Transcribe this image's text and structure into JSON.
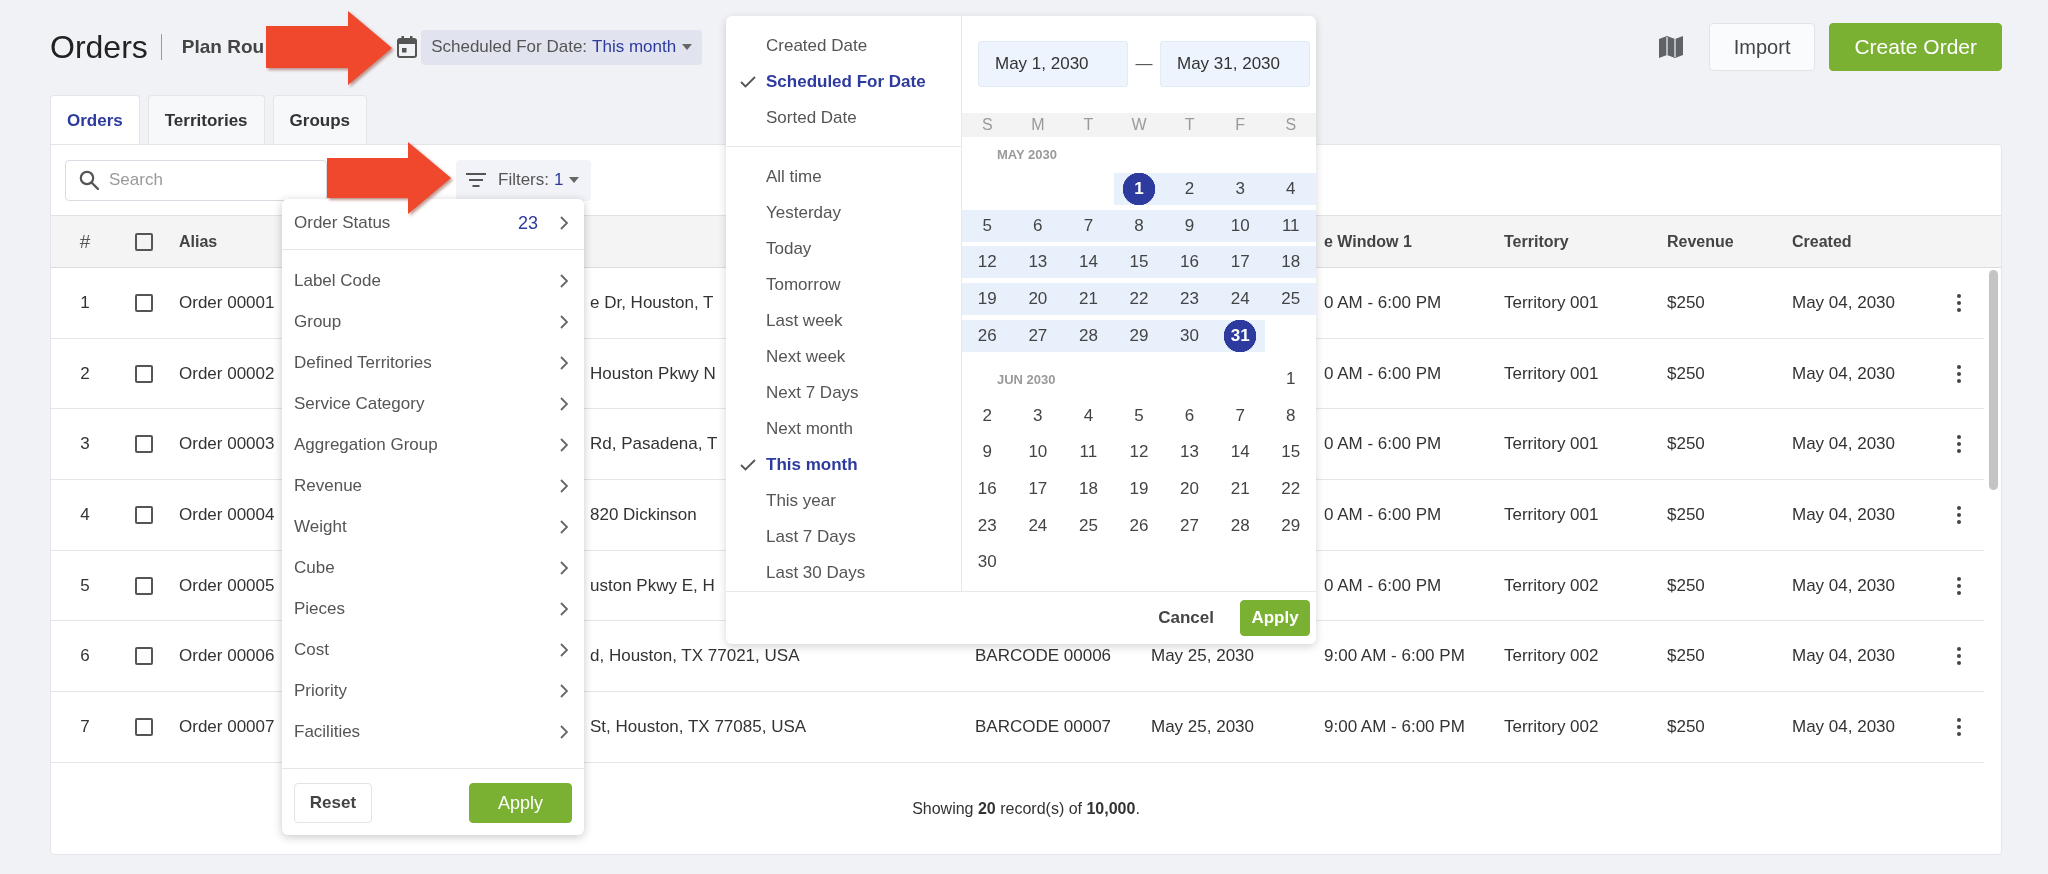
{
  "header": {
    "title": "Orders",
    "subtitle": "Plan Rou",
    "date_filter": {
      "label": "Scheduled For Date:",
      "value": "This month"
    },
    "buttons": [
      {
        "kind": "secondary",
        "label": "Import"
      },
      {
        "kind": "primary",
        "label": "Create Order"
      }
    ]
  },
  "tabs": [
    {
      "label": "Orders",
      "selected": true
    },
    {
      "label": "Territories",
      "selected": false
    },
    {
      "label": "Groups",
      "selected": false
    }
  ],
  "toolbar": {
    "search": {
      "placeholder": "Search"
    },
    "filters": {
      "label": "Filters:",
      "count": "1"
    }
  },
  "table": {
    "header": {
      "number": "#",
      "checked": false,
      "alias": "Alias",
      "column_7": "e Window 1",
      "territory": "Territory",
      "revenue": "Revenue",
      "created": "Created"
    },
    "rows": [
      {
        "number": "1",
        "checked": false,
        "alias": "Order 00001",
        "column_4": "e Dr, Houston, T",
        "column_7": "0 AM - 6:00 PM",
        "territory": "Territory 001",
        "revenue": "$250",
        "created": "May 04, 2030"
      },
      {
        "number": "2",
        "checked": false,
        "alias": "Order 00002",
        "column_4": "Houston Pkwy N",
        "column_7": "0 AM - 6:00 PM",
        "territory": "Territory 001",
        "revenue": "$250",
        "created": "May 04, 2030"
      },
      {
        "number": "3",
        "checked": false,
        "alias": "Order 00003",
        "column_4": "Rd, Pasadena, T",
        "column_7": "0 AM - 6:00 PM",
        "territory": "Territory 001",
        "revenue": "$250",
        "created": "May 04, 2030"
      },
      {
        "number": "4",
        "checked": false,
        "alias": "Order 00004",
        "column_4": "820 Dickinson",
        "column_7": "0 AM - 6:00 PM",
        "territory": "Territory 001",
        "revenue": "$250",
        "created": "May 04, 2030"
      },
      {
        "number": "5",
        "checked": false,
        "alias": "Order 00005",
        "column_4": "uston Pkwy E, H",
        "column_7": "0 AM - 6:00 PM",
        "territory": "Territory 002",
        "revenue": "$250",
        "created": "May 04, 2030"
      },
      {
        "number": "6",
        "checked": false,
        "alias": "Order 00006",
        "column_4": "d, Houston, TX 77021, USA",
        "column_5": "BARCODE 00006",
        "column_6": "May 25, 2030",
        "column_7": "9:00 AM - 6:00 PM",
        "territory": "Territory 002",
        "revenue": "$250",
        "created": "May 04, 2030"
      },
      {
        "number": "7",
        "checked": false,
        "alias": "Order 00007",
        "column_4": "St, Houston, TX 77085, USA",
        "column_5": "BARCODE 00007",
        "column_6": "May 25, 2030",
        "column_7": "9:00 AM - 6:00 PM",
        "territory": "Territory 002",
        "revenue": "$250",
        "created": "May 04, 2030"
      }
    ]
  },
  "footer": {
    "text": "Showing **20** record(s) of **10,000**."
  },
  "filter_menu": {
    "sections": [
      [
        {
          "label": "Order Status",
          "count": "23"
        }
      ],
      [
        {
          "label": "Label Code"
        },
        {
          "label": "Group"
        },
        {
          "label": "Defined Territories"
        },
        {
          "label": "Service Category"
        },
        {
          "label": "Aggregation Group"
        },
        {
          "label": "Revenue"
        },
        {
          "label": "Weight"
        },
        {
          "label": "Cube"
        },
        {
          "label": "Pieces"
        },
        {
          "label": "Cost"
        },
        {
          "label": "Priority"
        },
        {
          "label": "Facilities"
        }
      ]
    ],
    "buttons": [
      {
        "kind": "secondary",
        "label": "Reset"
      },
      {
        "kind": "primary",
        "label": "Apply"
      }
    ]
  },
  "date_menu": {
    "fields": [
      {
        "label": "Created Date",
        "selected": false
      },
      {
        "label": "Scheduled For Date",
        "selected": true
      },
      {
        "label": "Sorted Date",
        "selected": false
      }
    ],
    "presets": [
      {
        "label": "All time",
        "selected": false
      },
      {
        "label": "Yesterday",
        "selected": false
      },
      {
        "label": "Today",
        "selected": false
      },
      {
        "label": "Tomorrow",
        "selected": false
      },
      {
        "label": "Last week",
        "selected": false
      },
      {
        "label": "Next week",
        "selected": false
      },
      {
        "label": "Next 7 Days",
        "selected": false
      },
      {
        "label": "Next month",
        "selected": false
      },
      {
        "label": "This month",
        "selected": true
      },
      {
        "label": "This year",
        "selected": false
      },
      {
        "label": "Last 7 Days",
        "selected": false
      },
      {
        "label": "Last 30 Days",
        "selected": false
      }
    ],
    "range": {
      "start": "May 1, 2030",
      "separator": "—",
      "end": "May 31, 2030"
    },
    "weekdays": [
      "S",
      "M",
      "T",
      "W",
      "T",
      "F",
      "S"
    ],
    "months": [
      {
        "label": "MAY 2030",
        "weeks": [
          [
            {
              "day": "1",
              "selected": true
            },
            {
              "day": "2",
              "selected": false
            },
            {
              "day": "3",
              "selected": false
            },
            {
              "day": "4",
              "selected": false
            }
          ],
          [
            {
              "day": "5",
              "selected": false
            },
            {
              "day": "6",
              "selected": false
            },
            {
              "day": "7",
              "selected": false
            },
            {
              "day": "8",
              "selected": false
            },
            {
              "day": "9",
              "selected": false
            },
            {
              "day": "10",
              "selected": false
            },
            {
              "day": "11",
              "selected": false
            }
          ],
          [
            {
              "day": "12",
              "selected": false
            },
            {
              "day": "13",
              "selected": false
            },
            {
              "day": "14",
              "selected": false
            },
            {
              "day": "15",
              "selected": false
            },
            {
              "day": "16",
              "selected": false
            },
            {
              "day": "17",
              "selected": false
            },
            {
              "day": "18",
              "selected": false
            }
          ],
          [
            {
              "day": "19",
              "selected": false
            },
            {
              "day": "20",
              "selected": false
            },
            {
              "day": "21",
              "selected": false
            },
            {
              "day": "22",
              "selected": false
            },
            {
              "day": "23",
              "selected": false
            },
            {
              "day": "24",
              "selected": false
            },
            {
              "day": "25",
              "selected": false
            }
          ],
          [
            {
              "day": "26",
              "selected": false
            },
            {
              "day": "27",
              "selected": false
            },
            {
              "day": "28",
              "selected": false
            },
            {
              "day": "29",
              "selected": false
            },
            {
              "day": "30",
              "selected": false
            },
            {
              "day": "31",
              "selected": true
            }
          ]
        ]
      },
      {
        "label": "JUN 2030",
        "weeks": [
          [
            {
              "day": "1",
              "selected": false
            }
          ],
          [
            {
              "day": "2",
              "selected": false
            },
            {
              "day": "3",
              "selected": false
            },
            {
              "day": "4",
              "selected": false
            },
            {
              "day": "5",
              "selected": false
            },
            {
              "day": "6",
              "selected": false
            },
            {
              "day": "7",
              "selected": false
            },
            {
              "day": "8",
              "selected": false
            }
          ],
          [
            {
              "day": "9",
              "selected": false
            },
            {
              "day": "10",
              "selected": false
            },
            {
              "day": "11",
              "selected": false
            },
            {
              "day": "12",
              "selected": false
            },
            {
              "day": "13",
              "selected": false
            },
            {
              "day": "14",
              "selected": false
            },
            {
              "day": "15",
              "selected": false
            }
          ],
          [
            {
              "day": "16",
              "selected": false
            },
            {
              "day": "17",
              "selected": false
            },
            {
              "day": "18",
              "selected": false
            },
            {
              "day": "19",
              "selected": false
            },
            {
              "day": "20",
              "selected": false
            },
            {
              "day": "21",
              "selected": false
            },
            {
              "day": "22",
              "selected": false
            }
          ],
          [
            {
              "day": "23",
              "selected": false
            },
            {
              "day": "24",
              "selected": false
            },
            {
              "day": "25",
              "selected": false
            },
            {
              "day": "26",
              "selected": false
            },
            {
              "day": "27",
              "selected": false
            },
            {
              "day": "28",
              "selected": false
            },
            {
              "day": "29",
              "selected": false
            }
          ],
          [
            {
              "day": "30",
              "selected": false
            }
          ]
        ]
      }
    ],
    "buttons": [
      {
        "kind": "text",
        "label": "Cancel"
      },
      {
        "kind": "primary",
        "label": "Apply"
      }
    ]
  }
}
